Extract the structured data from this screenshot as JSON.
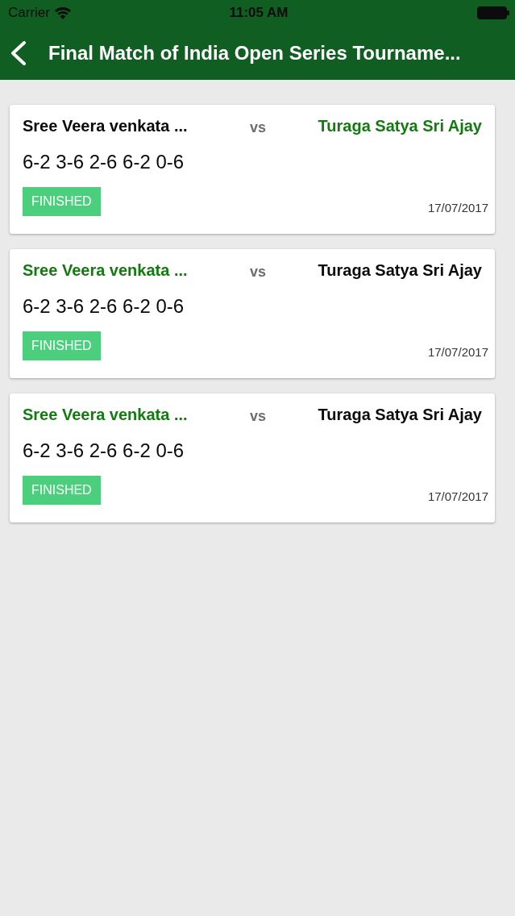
{
  "status_bar": {
    "carrier": "Carrier",
    "time": "11:05 AM"
  },
  "nav_bar": {
    "title": "Final Match of India Open Series Tourname..."
  },
  "matches": [
    {
      "players": [
        {
          "name": "Sree Veera venkata ...",
          "winner": false
        },
        {
          "name": "Turaga Satya Sri Ajay",
          "winner": true
        }
      ],
      "separator": "vs",
      "score": "6-2 3-6 2-6 6-2 0-6",
      "status": "FINISHED",
      "date": "17/07/2017"
    },
    {
      "players": [
        {
          "name": "Sree Veera venkata ...",
          "winner": true
        },
        {
          "name": "Turaga Satya Sri Ajay",
          "winner": false
        }
      ],
      "separator": "vs",
      "score": "6-2 3-6 2-6 6-2 0-6",
      "status": "FINISHED",
      "date": "17/07/2017"
    },
    {
      "players": [
        {
          "name": "Sree Veera venkata ...",
          "winner": true
        },
        {
          "name": "Turaga Satya Sri Ajay",
          "winner": false
        }
      ],
      "separator": "vs",
      "score": "6-2 3-6 2-6 6-2 0-6",
      "status": "FINISHED",
      "date": "17/07/2017"
    }
  ]
}
